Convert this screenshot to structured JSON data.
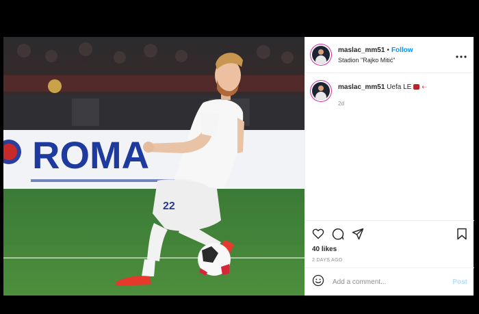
{
  "post": {
    "username": "maslac_mm51",
    "separator": "•",
    "follow_label": "Follow",
    "location": "Stadion \"Rajko Mitić\"",
    "more_icon": "more-horizontal-icon",
    "caption_user": "maslac_mm51",
    "caption_text": "Uefa LE",
    "caption_arrow": "⇠",
    "time_relative": "2d",
    "likes": "40 likes",
    "posted_ago": "2 DAYS AGO",
    "comment_placeholder": "Add a comment...",
    "post_label": "Post"
  },
  "photo": {
    "banner_text": "ROMA",
    "shirt_number": "22"
  },
  "colors": {
    "follow": "#0095f6",
    "post_disabled": "#b2dffc",
    "muted": "#8e8e8e",
    "text": "#262626"
  }
}
